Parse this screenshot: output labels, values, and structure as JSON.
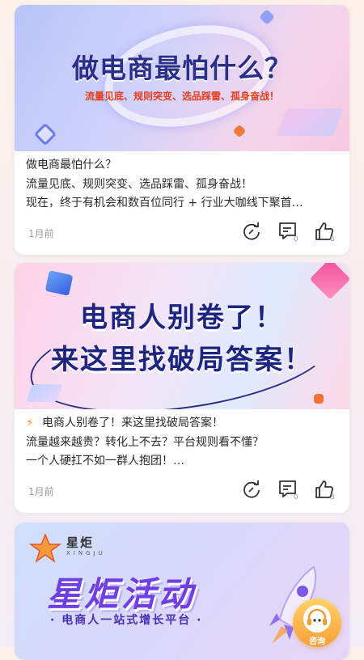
{
  "posts": [
    {
      "banner_title": "做电商最怕什么？",
      "banner_subtitle": "流量见底、规则突变、选品踩雷、孤身奋战！",
      "lines": [
        "做电商最怕什么？",
        "流量见底、规则突变、选品踩雷、孤身奋战！",
        "现在，终于有机会和数百位同行 + 行业大咖线下聚首…"
      ],
      "date": "1月前",
      "comment_count": "0",
      "like_count": "6"
    },
    {
      "banner_line1": "电商人别卷了！",
      "banner_line2": "来这里找破局答案！",
      "lines": [
        "电商人别卷了！来这里找破局答案！",
        "流量越来越贵？转化上不去？平台规则看不懂？",
        "一个人硬扛不如一群人抱团！…"
      ],
      "lead_icon": "lightning-icon",
      "date": "1月前",
      "comment_count": "0",
      "like_count": "3"
    },
    {
      "logo_text": "星炬",
      "logo_sub": "XINGJU",
      "banner_title": "星炬活动",
      "banner_slogan": "· 电商人一站式增长平台 ·"
    }
  ],
  "customer_service": {
    "label": "咨询",
    "icon": "headset-icon"
  },
  "icons": {
    "share": "share-icon",
    "comment": "comment-icon",
    "like": "thumbs-up-icon"
  },
  "colors": {
    "accent_orange": "#f59a2b",
    "title_navy": "#2b2f8a",
    "purple": "#6f3fe3"
  }
}
